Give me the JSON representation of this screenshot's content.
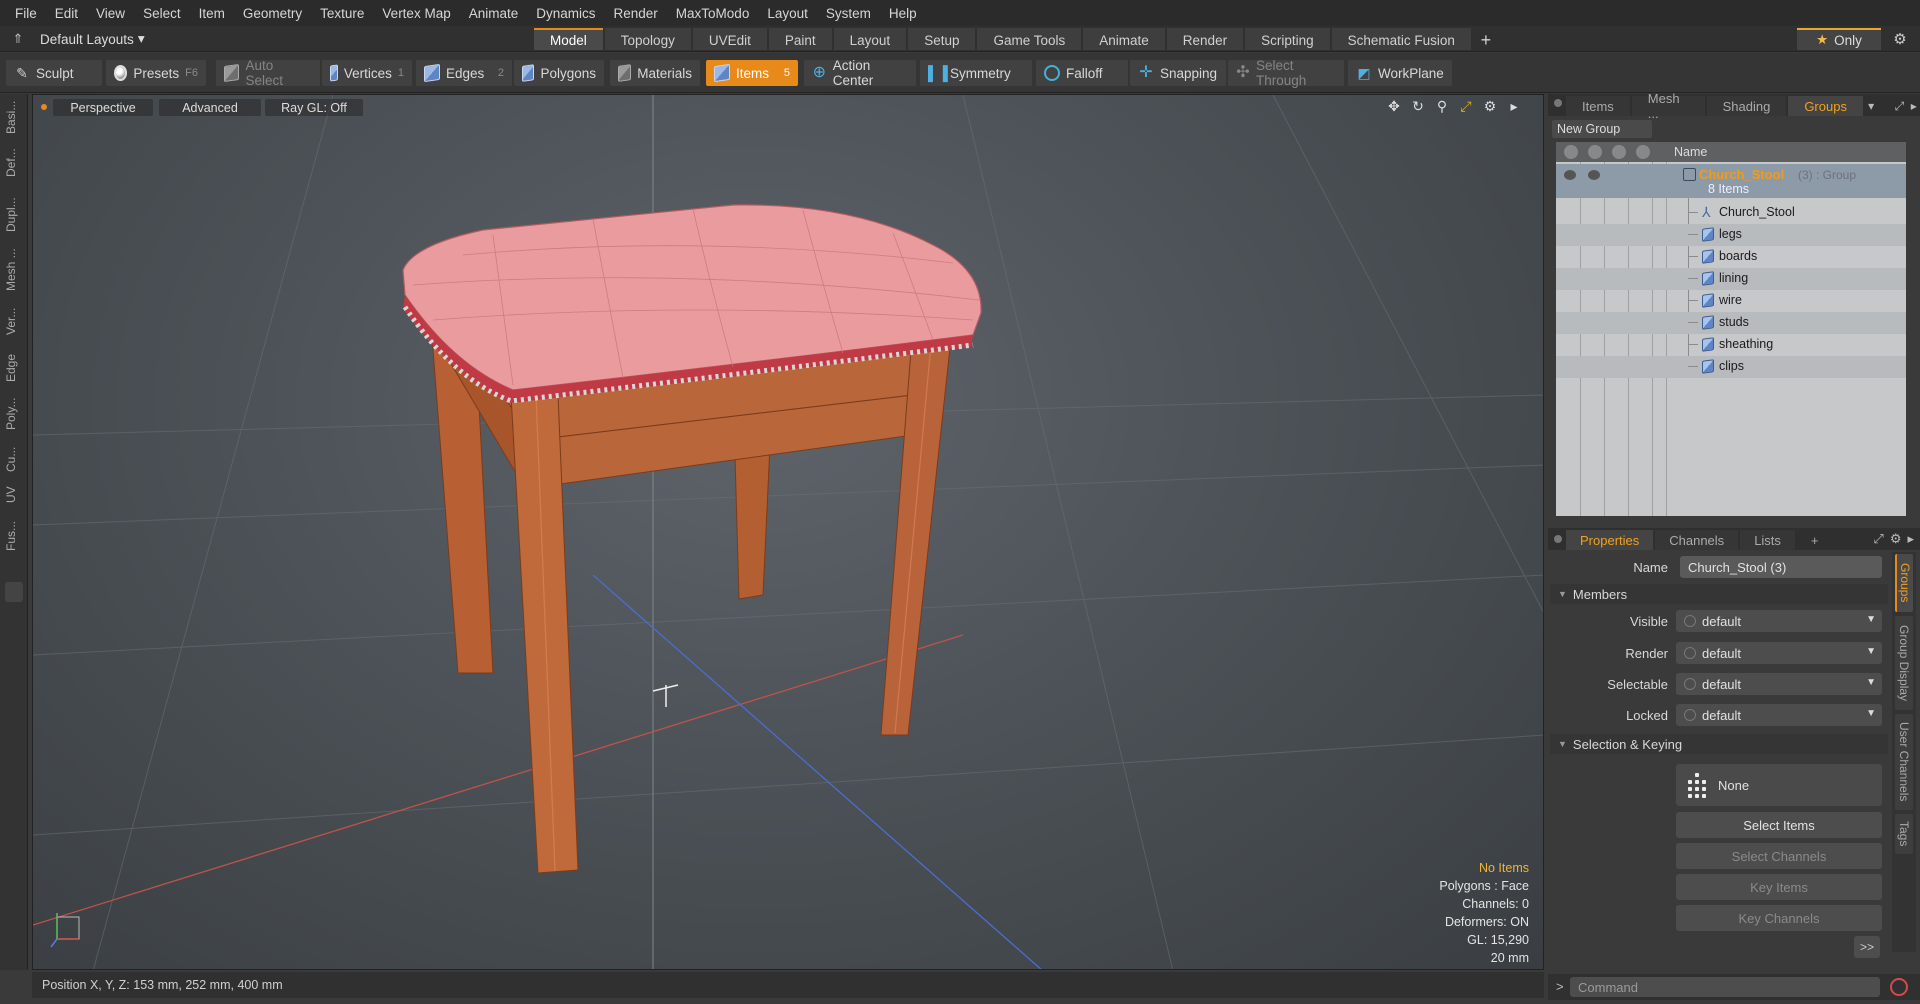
{
  "menu": [
    "File",
    "Edit",
    "View",
    "Select",
    "Item",
    "Geometry",
    "Texture",
    "Vertex Map",
    "Animate",
    "Dynamics",
    "Render",
    "MaxToModo",
    "Layout",
    "System",
    "Help"
  ],
  "layout_selector": {
    "label": "Default Layouts",
    "arrow": "▾"
  },
  "top_tabs": [
    "Model",
    "Topology",
    "UVEdit",
    "Paint",
    "Layout",
    "Setup",
    "Game Tools",
    "Animate",
    "Render",
    "Scripting",
    "Schematic Fusion"
  ],
  "top_tabs_active": "Model",
  "top_tab_add": "+",
  "only_button": {
    "star": "★",
    "label": "Only"
  },
  "toolbar": {
    "sculpt": "Sculpt",
    "presets": "Presets",
    "presets_key": "F6",
    "auto_select": "Auto Select",
    "vertices": "Vertices",
    "vertices_key": "1",
    "edges": "Edges",
    "edges_key": "2",
    "polygons": "Polygons",
    "materials": "Materials",
    "items": "Items",
    "items_key": "5",
    "action_center": "Action Center",
    "symmetry": "Symmetry",
    "falloff": "Falloff",
    "snapping": "Snapping",
    "select_through": "Select Through",
    "workplane": "WorkPlane"
  },
  "left_strip": [
    "Basi...",
    "Def...",
    "Dupl...",
    "Mesh ...",
    "Ver...",
    "Edge",
    "Poly...",
    "Cu...",
    "UV",
    "Fus..."
  ],
  "viewport": {
    "view_mode": "Perspective",
    "advanced": "Advanced",
    "raygl": "Ray GL: Off",
    "stats": {
      "no_items": "No Items",
      "polygons": "Polygons : Face",
      "channels": "Channels: 0",
      "deformers": "Deformers: ON",
      "gl": "GL: 15,290",
      "scale": "20 mm"
    }
  },
  "statusbar": {
    "position": "Position X, Y, Z:   153 mm, 252 mm, 400 mm"
  },
  "scene_panel": {
    "tabs": [
      "Items",
      "Mesh ...",
      "Shading",
      "Groups"
    ],
    "active_tab": "Groups",
    "new_group": "New Group",
    "column_name": "Name",
    "group": {
      "name": "Church_Stool",
      "meta": "(3) : Group",
      "count": "8 Items"
    },
    "children": [
      "Church_Stool",
      "legs",
      "boards",
      "lining",
      "wire",
      "studs",
      "sheathing",
      "clips"
    ]
  },
  "properties_panel": {
    "tabs": [
      "Properties",
      "Channels",
      "Lists",
      "+"
    ],
    "active_tab": "Properties",
    "name_label": "Name",
    "name_value": "Church_Stool (3)",
    "members_section": "Members",
    "visible_label": "Visible",
    "visible_value": "default",
    "render_label": "Render",
    "render_value": "default",
    "selectable_label": "Selectable",
    "selectable_value": "default",
    "locked_label": "Locked",
    "locked_value": "default",
    "selection_section": "Selection & Keying",
    "none_label": "None",
    "select_items": "Select Items",
    "select_channels": "Select Channels",
    "key_items": "Key Items",
    "key_channels": "Key Channels",
    "more": ">>"
  },
  "side_tabs": [
    "Groups",
    "Group Display",
    "User Channels",
    "Tags"
  ],
  "command": {
    "prompt": ">",
    "placeholder": "Command"
  },
  "colors": {
    "accent": "#e88a1a",
    "group_name": "#f29a1a",
    "cushion": "#e99b9e",
    "wood": "#b05a2e"
  }
}
